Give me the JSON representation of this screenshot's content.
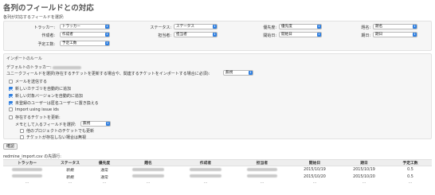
{
  "page": {
    "title": "各列のフィールドとの対応"
  },
  "mapping": {
    "section_label": "各列が対応するフィールドを選択:",
    "fields": [
      {
        "label": "トラッカー:",
        "value": "トラッカー"
      },
      {
        "label": "作成者:",
        "value": "作成者"
      },
      {
        "label": "予定工数:",
        "value": "予定工数"
      },
      {
        "label": "ステータス:",
        "value": "ステータス"
      },
      {
        "label": "担当者:",
        "value": "担当者"
      },
      {
        "label": "優先度:",
        "value": "優先度"
      },
      {
        "label": "開始日:",
        "value": "開始日"
      },
      {
        "label": "題名:",
        "value": "題名"
      },
      {
        "label": "期日:",
        "value": "期日"
      }
    ]
  },
  "rules": {
    "section_label": "インポートのルール",
    "default_tracker_label": "デフォルトのトラッカー:",
    "unique_field_label": "ユニークフィールドを選択(存在するチケットを更新する場合や、関連するチケットをインポートする場合に必須):",
    "unique_field_value": "無視",
    "checkboxes": [
      {
        "label": "メールを送信する",
        "checked": false
      },
      {
        "label": "新しいカテゴリを自動的に追加",
        "checked": true
      },
      {
        "label": "新しい対象バージョンを自動的に追加",
        "checked": true
      },
      {
        "label": "未登録のユーザーは匿名ユーザーに置き換える",
        "checked": true
      },
      {
        "label": "Import using issue ids",
        "checked": false
      },
      {
        "label": "存在するチケットを更新:",
        "checked": false
      }
    ],
    "update_fields_label": "メモとして入るフィールドを選択:",
    "update_fields_value": "無視",
    "sub_checkboxes": [
      {
        "label": "他のプロジェクトのチケットでも更新",
        "checked": false
      },
      {
        "label": "チケットが存在しない場合は無視",
        "checked": false
      }
    ]
  },
  "actions": {
    "submit_label": "確認"
  },
  "preview": {
    "label": "redmine_import.csv の先頭行:",
    "columns": [
      "トラッカー",
      "ステータス",
      "優先度",
      "題名",
      "作成者",
      "担当者",
      "開始日",
      "期日",
      "予定工数"
    ],
    "rows": [
      [
        "",
        "新規",
        "通常",
        "",
        "",
        "",
        "2015/10/19",
        "2015/10/19",
        "0.5"
      ],
      [
        "",
        "新規",
        "通常",
        "",
        "",
        "",
        "2015/10/20",
        "2015/10/20",
        "0.5"
      ]
    ],
    "ellipsis": "..."
  }
}
